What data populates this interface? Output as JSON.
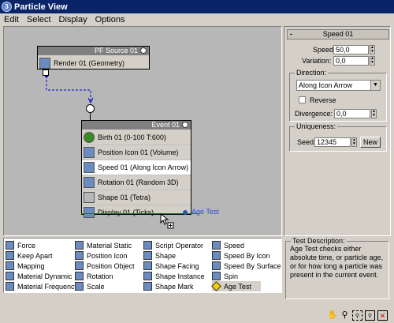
{
  "window": {
    "title": "Particle View"
  },
  "menu": [
    "Edit",
    "Select",
    "Display",
    "Options"
  ],
  "source_node": {
    "title": "PF Source 01",
    "ops": [
      "Render 01 (Geometry)"
    ]
  },
  "event_node": {
    "title": "Event 01",
    "ops": [
      "Birth 01 (0-100 T:600)",
      "Position Icon 01 (Volume)",
      "Speed 01 (Along Icon Arrow)",
      "Rotation 01 (Random 3D)",
      "Shape 01 (Tetra)",
      "Display 01 (Ticks)"
    ],
    "selected_index": 2
  },
  "drag_label": "Age Test",
  "rollout": {
    "title": "Speed 01",
    "speed_label": "Speed:",
    "speed_value": "50,0",
    "variation_label": "Variation:",
    "variation_value": "0,0",
    "direction_group": "Direction:",
    "direction_value": "Along Icon Arrow",
    "reverse_label": "Reverse",
    "reverse_checked": false,
    "divergence_label": "Divergence:",
    "divergence_value": "0,0",
    "uniqueness_group": "Uniqueness:",
    "seed_label": "Seed:",
    "seed_value": "12345",
    "new_label": "New"
  },
  "depot": {
    "columns": [
      [
        "Force",
        "Keep Apart",
        "Mapping",
        "Material Dynamic",
        "Material Frequency"
      ],
      [
        "Material Static",
        "Position Icon",
        "Position Object",
        "Rotation",
        "Scale"
      ],
      [
        "Script Operator",
        "Shape",
        "Shape Facing",
        "Shape Instance",
        "Shape Mark"
      ],
      [
        "Speed",
        "Speed By Icon",
        "Speed By Surface",
        "Spin",
        "Age Test"
      ]
    ],
    "selected": "Age Test"
  },
  "description": {
    "title": "Test Description:",
    "text": "Age Test checks either absolute time, or particle age, or for how long a particle was present in the current event."
  },
  "toolbar_icons": [
    "pan-icon",
    "zoom-icon",
    "zoom-region-icon",
    "zoom-extents-icon",
    "no-zoom-icon"
  ]
}
